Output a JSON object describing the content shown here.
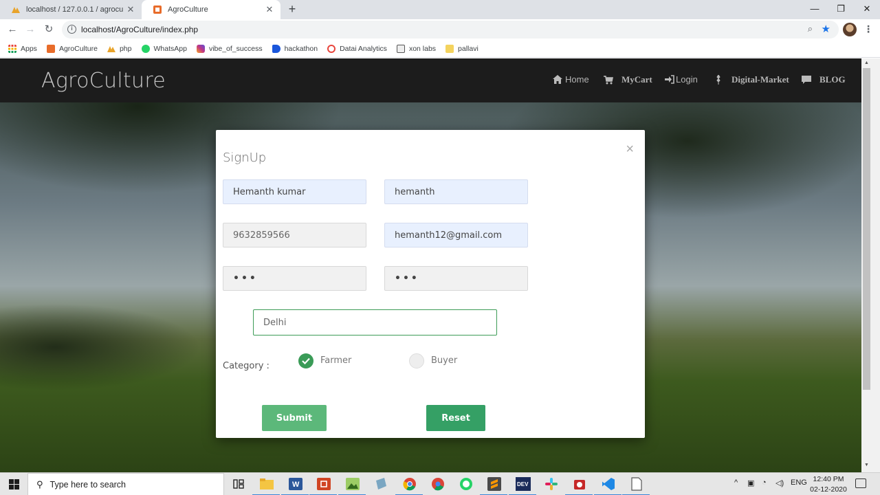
{
  "browser": {
    "tabs": [
      {
        "title": "localhost / 127.0.0.1 / agroculture",
        "close": "✕"
      },
      {
        "title": "AgroCulture",
        "close": "✕"
      }
    ],
    "new_tab": "+",
    "window_controls": {
      "minimize": "—",
      "maximize": "❐",
      "close": "✕"
    },
    "url": "localhost/AgroCulture/index.php",
    "bookmarks": [
      {
        "label": "Apps",
        "color": "#e8453c"
      },
      {
        "label": "AgroCulture",
        "color": "#e86c2a"
      },
      {
        "label": "php",
        "color": "#e8a32a"
      },
      {
        "label": "WhatsApp",
        "color": "#25d366"
      },
      {
        "label": "vibe_of_success",
        "color": "#c13584"
      },
      {
        "label": "hackathon",
        "color": "#1a56db"
      },
      {
        "label": "Datai Analytics",
        "color": "#e8453c"
      },
      {
        "label": "xon labs",
        "color": "#555555"
      },
      {
        "label": "pallavi",
        "color": "#f4d35e"
      }
    ]
  },
  "site": {
    "brand": "AgroCulture",
    "nav": [
      {
        "label": "Home",
        "icon": "home-icon"
      },
      {
        "label": "MyCart",
        "icon": "cart-icon"
      },
      {
        "label": "Login",
        "icon": "login-icon"
      },
      {
        "label": "Digital-Market",
        "icon": "grain-icon"
      },
      {
        "label": "BLOG",
        "icon": "comment-icon"
      }
    ]
  },
  "signup": {
    "title": "SignUp",
    "close": "×",
    "fields": {
      "name": "Hemanth kumar",
      "username": "hemanth",
      "mobile": "9632859566",
      "email": "hemanth12@gmail.com",
      "password": "•••",
      "confirm_password": "•••",
      "address": "Delhi"
    },
    "category_label": "Category :",
    "categories": [
      {
        "label": "Farmer",
        "selected": true
      },
      {
        "label": "Buyer",
        "selected": false
      }
    ],
    "submit_label": "Submit",
    "reset_label": "Reset",
    "accent_color": "#3a9b57"
  },
  "taskbar": {
    "search_placeholder": "Type here to search",
    "language": "ENG",
    "time": "12:40 PM",
    "date": "02-12-2020"
  }
}
